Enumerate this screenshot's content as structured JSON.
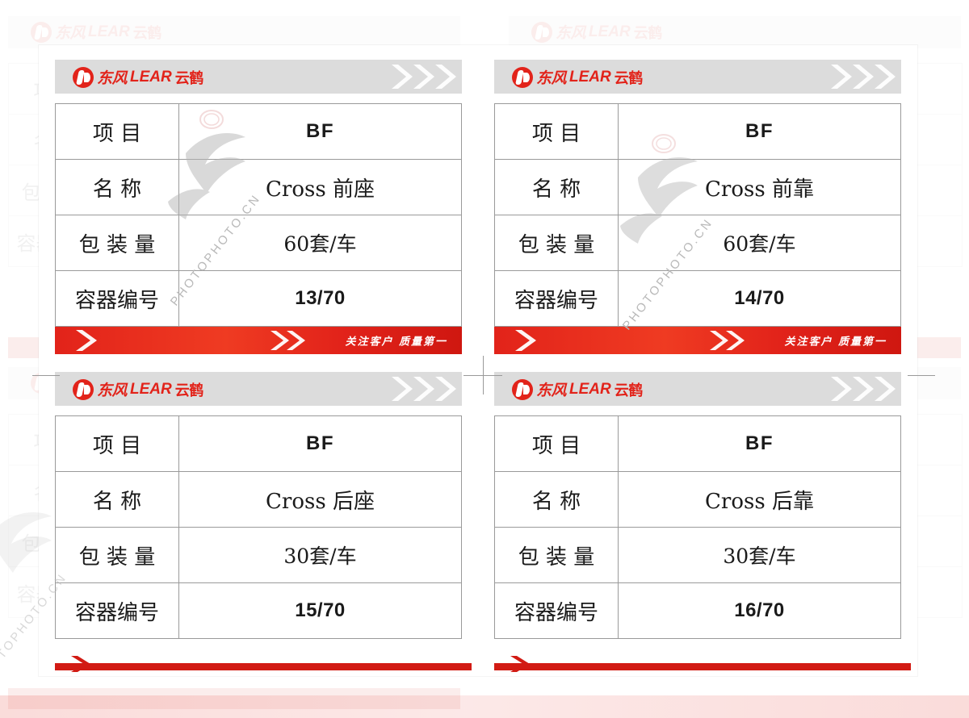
{
  "brand": {
    "logo_cn_left": "东风",
    "logo_latin": "LEAR",
    "logo_cn_right": "云鹤",
    "logo_alt": "东风LEAR云鹤",
    "red": "#e2231a",
    "header_gray": "#dcdcdc"
  },
  "banner": {
    "slogan": "关注客户  质量第一"
  },
  "table_labels": {
    "item": "项      目",
    "name": "名      称",
    "packing": "包 装 量",
    "container": "容器编号"
  },
  "cards": [
    {
      "position": "top-left",
      "item": "BF",
      "name": "Cross 前座",
      "packing": "60套/车",
      "container": "13/70"
    },
    {
      "position": "top-right",
      "item": "BF",
      "name": "Cross 前靠",
      "packing": "60套/车",
      "container": "14/70"
    },
    {
      "position": "bottom-left",
      "item": "BF",
      "name": "Cross 后座",
      "packing": "30套/车",
      "container": "15/70"
    },
    {
      "position": "bottom-right",
      "item": "BF",
      "name": "Cross 后靠",
      "packing": "30套/车",
      "container": "16/70"
    }
  ],
  "watermark": {
    "text": "PHOTOPHOTO.CN"
  }
}
